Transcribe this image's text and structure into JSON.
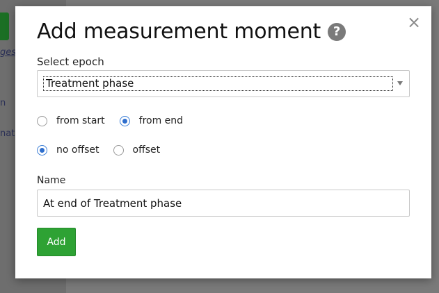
{
  "background": {
    "left_fragments": [
      "ges",
      "n",
      "nati"
    ]
  },
  "modal": {
    "title": "Add measurement moment",
    "help_icon_glyph": "?",
    "close_glyph": "×",
    "epoch": {
      "label": "Select epoch",
      "selected": "Treatment phase"
    },
    "reference": {
      "options": [
        {
          "label": "from start",
          "checked": false
        },
        {
          "label": "from end",
          "checked": true
        }
      ]
    },
    "offset": {
      "options": [
        {
          "label": "no offset",
          "checked": true
        },
        {
          "label": "offset",
          "checked": false
        }
      ]
    },
    "name": {
      "label": "Name",
      "value": "At end of Treatment phase"
    },
    "add_button_label": "Add"
  },
  "colors": {
    "accent_green": "#2ea234",
    "radio_blue": "#2f6fcd",
    "overlay": "#6f6f6f"
  },
  "icons": [
    "help-icon",
    "close-icon",
    "chevron-down-icon"
  ]
}
